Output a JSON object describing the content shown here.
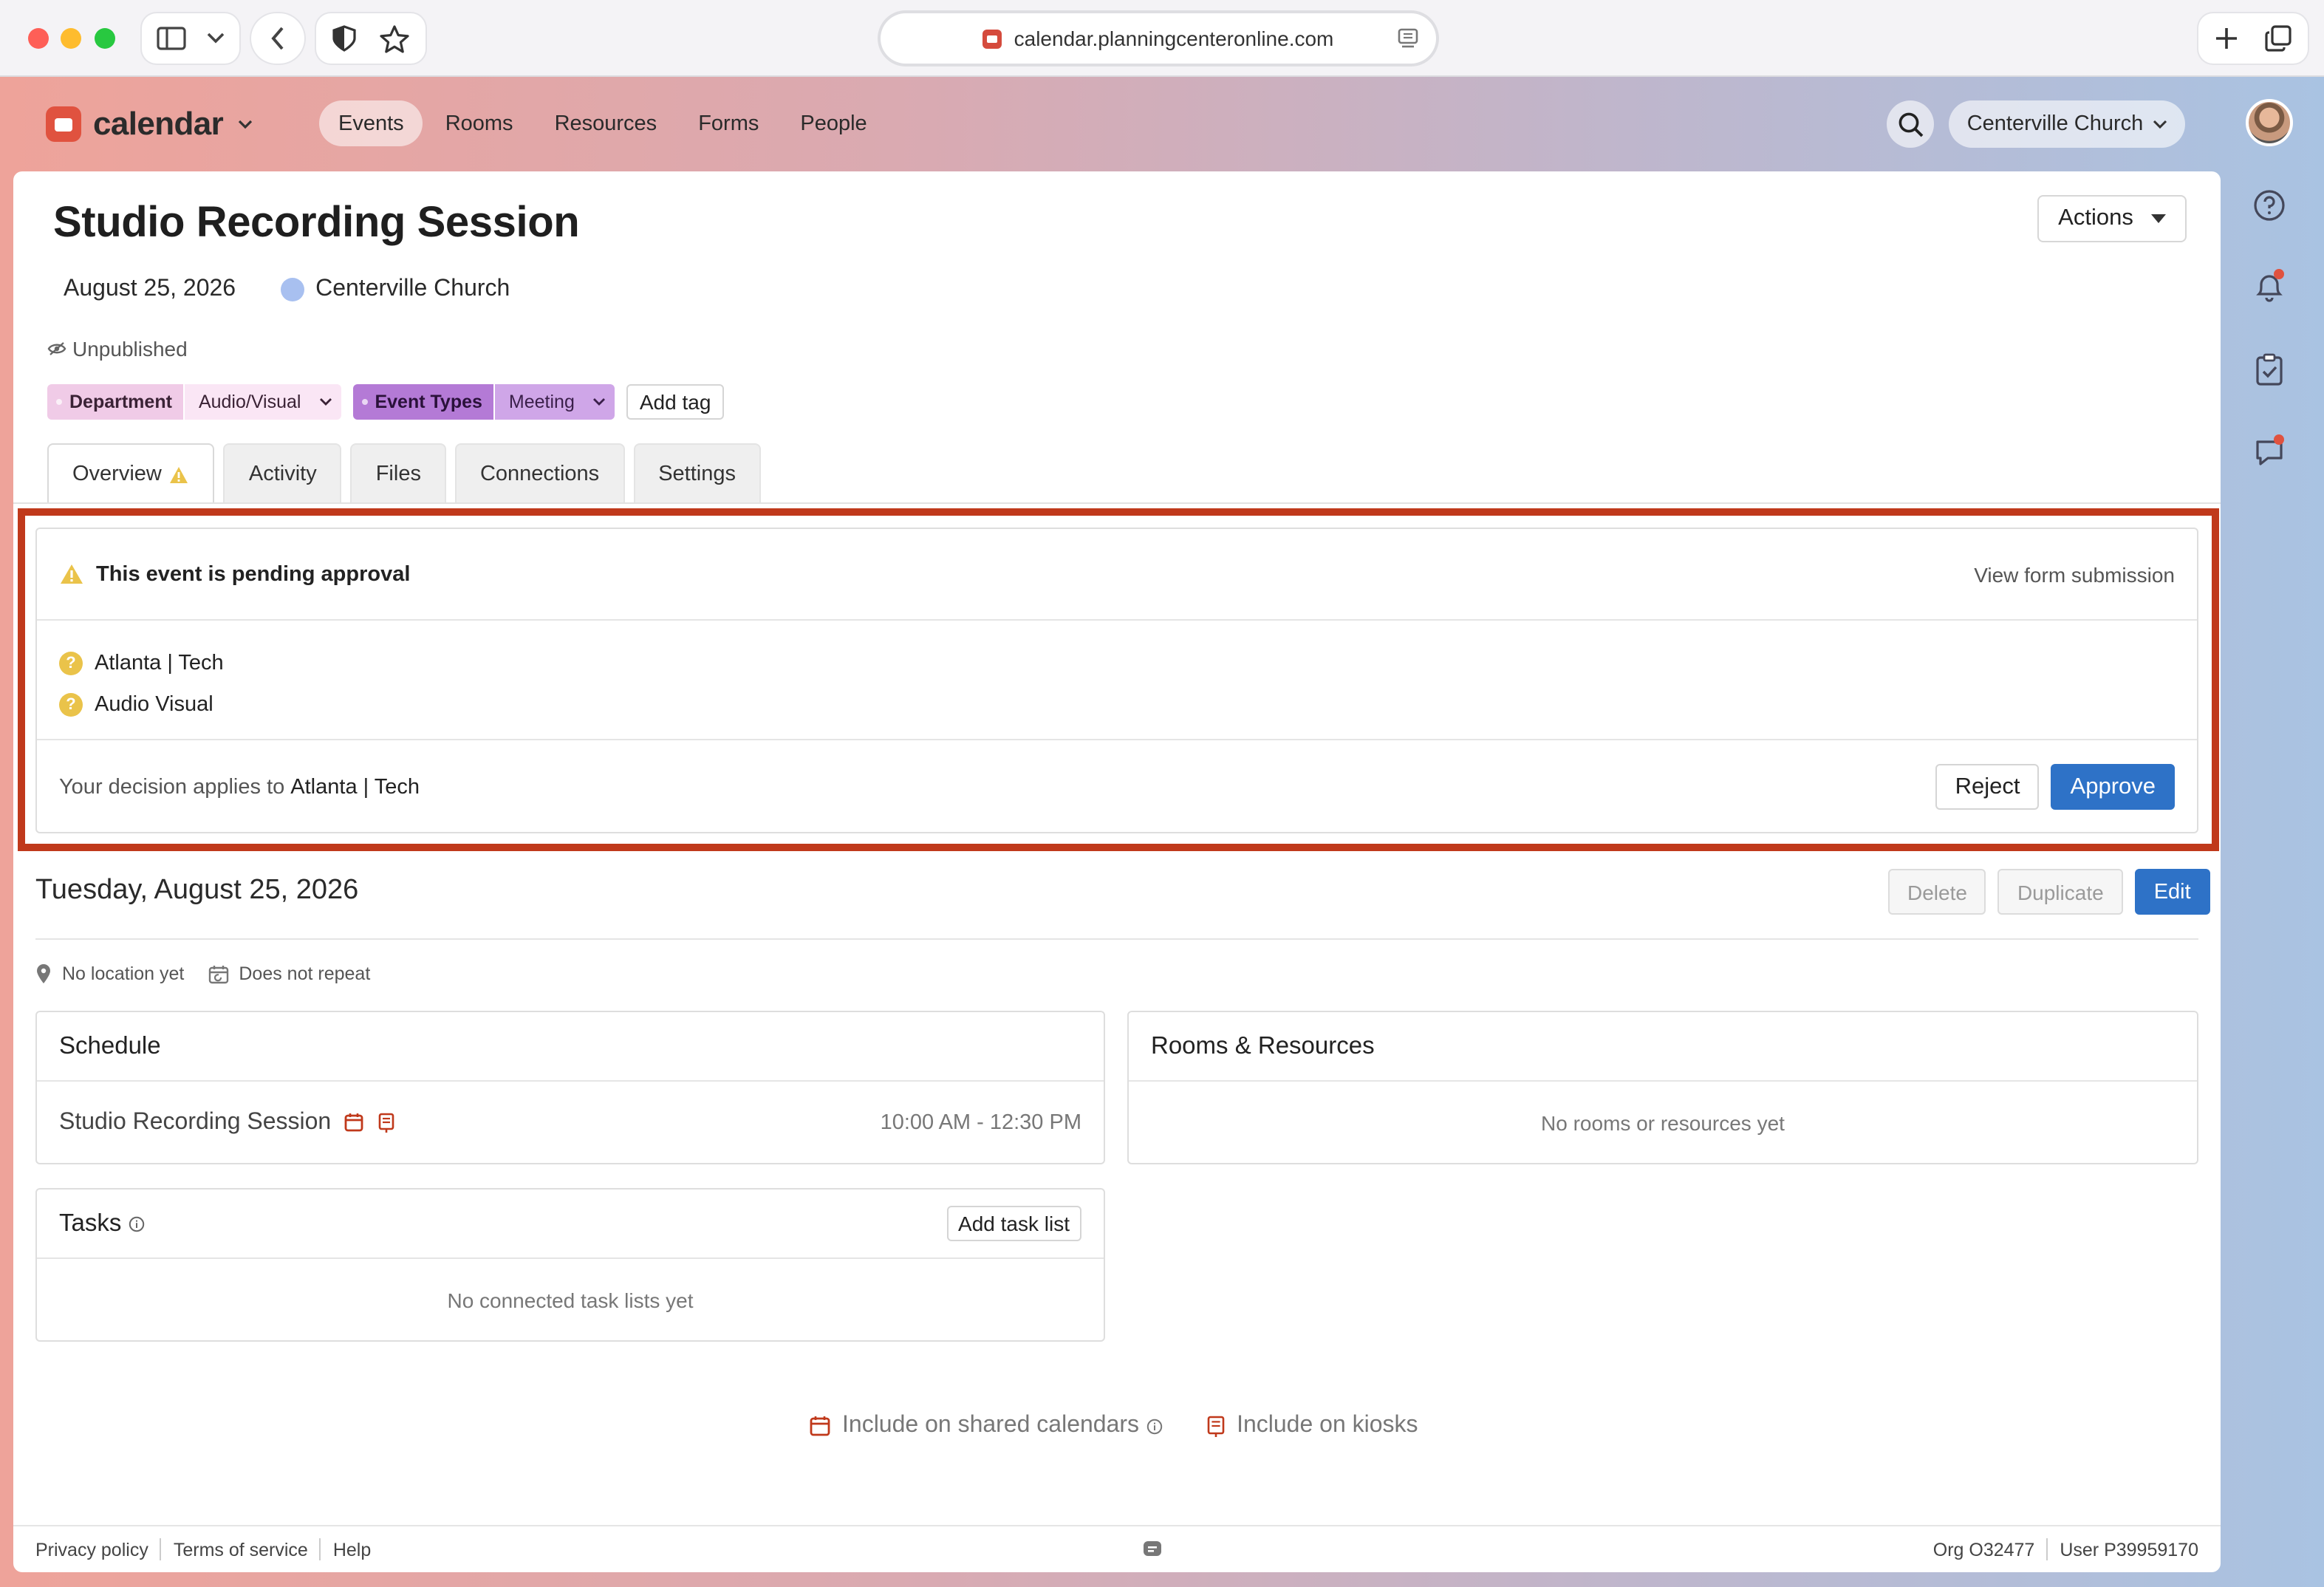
{
  "browser": {
    "url": "calendar.planningcenteronline.com"
  },
  "app": {
    "name": "calendar",
    "nav": [
      "Events",
      "Rooms",
      "Resources",
      "Forms",
      "People"
    ],
    "active_nav": "Events",
    "org_name": "Centerville Church"
  },
  "event": {
    "title": "Studio Recording Session",
    "date": "August 25, 2026",
    "calendar": "Centerville Church",
    "status": "Unpublished",
    "actions_label": "Actions",
    "tags": [
      {
        "group": "Department",
        "value": "Audio/Visual"
      },
      {
        "group": "Event Types",
        "value": "Meeting"
      }
    ],
    "add_tag_label": "Add tag",
    "tabs": [
      "Overview",
      "Activity",
      "Files",
      "Connections",
      "Settings"
    ]
  },
  "approval": {
    "message": "This event is pending approval",
    "view_link": "View form submission",
    "approvers": [
      "Atlanta | Tech",
      "Audio Visual"
    ],
    "decision_prefix": "Your decision applies to",
    "decision_target": "Atlanta | Tech",
    "reject_label": "Reject",
    "approve_label": "Approve"
  },
  "occurrence": {
    "date": "Tuesday, August 25, 2026",
    "delete_label": "Delete",
    "duplicate_label": "Duplicate",
    "edit_label": "Edit",
    "location": "No location yet",
    "repeat": "Does not repeat"
  },
  "schedule": {
    "title": "Schedule",
    "item_name": "Studio Recording Session",
    "item_time": "10:00 AM - 12:30 PM"
  },
  "rooms": {
    "title": "Rooms & Resources",
    "empty": "No rooms or resources yet"
  },
  "tasks": {
    "title": "Tasks",
    "add_label": "Add task list",
    "empty": "No connected task lists yet"
  },
  "includes": {
    "shared": "Include on shared calendars",
    "kiosks": "Include on kiosks"
  },
  "footer": {
    "privacy": "Privacy policy",
    "terms": "Terms of service",
    "help": "Help",
    "org": "Org O32477",
    "user": "User P39959170"
  },
  "colors": {
    "accent": "#2e72c7",
    "brand": "#e0523f",
    "highlight": "#c0391b"
  }
}
